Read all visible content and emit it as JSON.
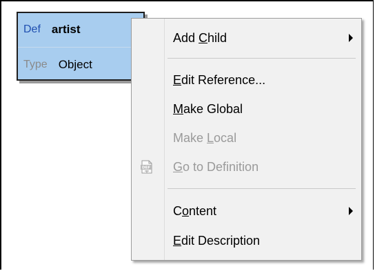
{
  "def_box": {
    "def_label": "Def",
    "def_value": "artist",
    "type_label": "Type",
    "type_value": "Object"
  },
  "context_menu": {
    "items": [
      {
        "pre": "Add ",
        "key": "C",
        "post": "hild",
        "enabled": true,
        "submenu": true
      },
      {
        "pre": "",
        "key": "E",
        "post": "dit Reference...",
        "enabled": true,
        "submenu": false
      },
      {
        "pre": "",
        "key": "M",
        "post": "ake Global",
        "enabled": true,
        "submenu": false
      },
      {
        "pre": "Make ",
        "key": "L",
        "post": "ocal",
        "enabled": false,
        "submenu": false
      },
      {
        "pre": "",
        "key": "G",
        "post": "o to Definition",
        "enabled": false,
        "submenu": false,
        "icon": "go-to-definition-icon",
        "icon_text": "DEF"
      },
      {
        "pre": "C",
        "key": "o",
        "post": "ntent",
        "enabled": true,
        "submenu": true
      },
      {
        "pre": "",
        "key": "E",
        "post": "dit Description",
        "enabled": true,
        "submenu": false
      }
    ]
  },
  "colors": {
    "def_box_bg": "#a8cdef",
    "def_key": "#1f4fb0",
    "menu_bg": "#f1f1f1",
    "disabled_text": "#9a9a9a"
  }
}
